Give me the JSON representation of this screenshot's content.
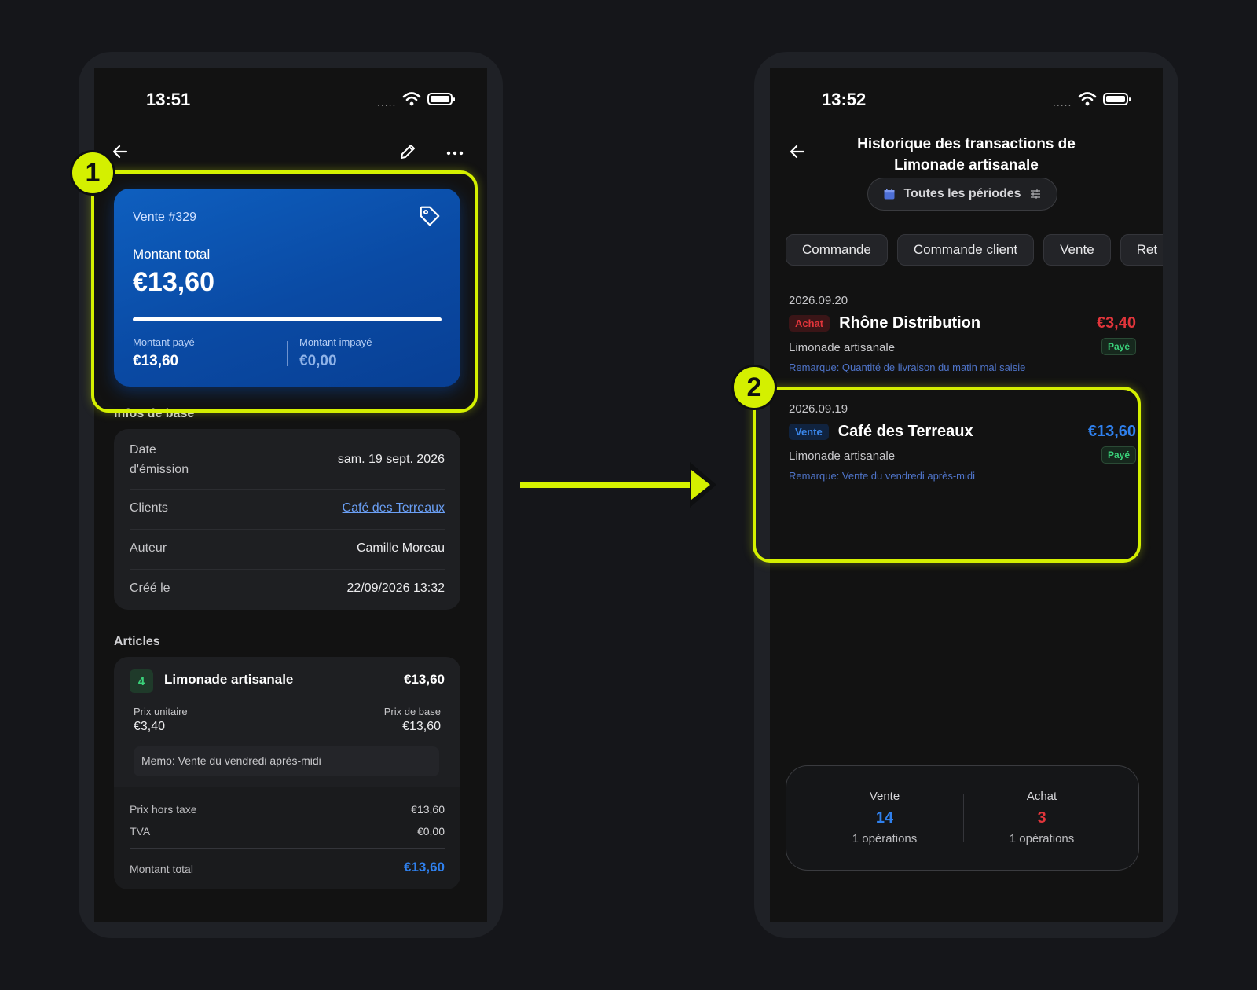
{
  "left": {
    "status": {
      "time": "13:51",
      "dots": "....."
    },
    "hero": {
      "title": "Vente #329",
      "total_label": "Montant total",
      "total": "€13,60",
      "paid_label": "Montant payé",
      "paid": "€13,60",
      "unpaid_label": "Montant impayé",
      "unpaid": "€0,00"
    },
    "basic_section": "Infos de base",
    "info": [
      {
        "key": "Date\nd'émission",
        "value": "sam. 19 sept. 2026"
      },
      {
        "key": "Clients",
        "value": "Café des Terreaux"
      },
      {
        "key": "Auteur",
        "value": "Camille Moreau"
      },
      {
        "key": "Créé le",
        "value": "22/09/2026 13:32"
      }
    ],
    "articles_section": "Articles",
    "article": {
      "qty": "4",
      "name": "Limonade artisanale",
      "price": "€13,60",
      "unit_label": "Prix unitaire",
      "unit": "€3,40",
      "base_label": "Prix de base",
      "base": "€13,60",
      "memo": "Memo: Vente du vendredi après-midi"
    },
    "totals": [
      {
        "label": "Prix hors taxe",
        "value": "€13,60"
      },
      {
        "label": "TVA",
        "value": "€0,00"
      }
    ],
    "grand_total_label": "Montant total",
    "grand_total": "€13,60"
  },
  "right": {
    "status": {
      "time": "13:52",
      "dots": "....."
    },
    "title": "Historique des transactions de Limonade artisanale",
    "period": "Toutes les périodes",
    "chips": [
      "Commande",
      "Commande client",
      "Vente",
      "Ret"
    ],
    "transactions": [
      {
        "date": "2026.09.20",
        "type": "Achat",
        "party": "Rhône Distribution",
        "amount": "€3,40",
        "product": "Limonade artisanale",
        "status": "Payé",
        "note": "Remarque: Quantité de livraison du matin mal saisie"
      },
      {
        "date": "2026.09.19",
        "type": "Vente",
        "party": "Café des Terreaux",
        "amount": "€13,60",
        "product": "Limonade artisanale",
        "status": "Payé",
        "note": "Remarque: Vente du vendredi après-midi"
      }
    ],
    "summary": {
      "sale_label": "Vente",
      "sale_count": "14",
      "sale_ops": "1 opérations",
      "buy_label": "Achat",
      "buy_count": "3",
      "buy_ops": "1 opérations"
    }
  },
  "callouts": [
    "1",
    "2"
  ],
  "colors": {
    "highlight": "#d4f000",
    "accent_blue": "#2f80ed",
    "accent_red": "#e1353b",
    "paid_green": "#3ad27a"
  }
}
